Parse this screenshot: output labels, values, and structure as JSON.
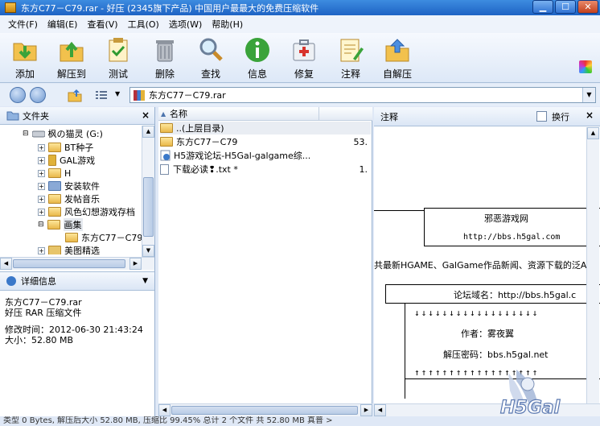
{
  "window": {
    "title": "东方C77－C79.rar - 好压 (2345旗下产品) 中国用户最最大的免费压缩软件",
    "minimize": "▁",
    "maximize": "☐",
    "close": "✕"
  },
  "menu": [
    "文件(F)",
    "编辑(E)",
    "查看(V)",
    "工具(O)",
    "选项(W)",
    "帮助(H)"
  ],
  "toolbar": [
    {
      "label": "添加",
      "icon": "add-icon"
    },
    {
      "label": "解压到",
      "icon": "extract-to-icon"
    },
    {
      "label": "测试",
      "icon": "test-icon"
    },
    {
      "label": "删除",
      "icon": "delete-icon"
    },
    {
      "label": "查找",
      "icon": "find-icon"
    },
    {
      "label": "信息",
      "icon": "info-icon"
    },
    {
      "label": "修复",
      "icon": "repair-icon"
    },
    {
      "label": "注释",
      "icon": "comment-icon"
    },
    {
      "label": "自解压",
      "icon": "sfx-icon"
    }
  ],
  "address": {
    "path": "东方C77－C79.rar"
  },
  "folder_panel": {
    "title": "文件夹",
    "close": "×",
    "tree": [
      {
        "label": "枫の猫灵 (G:)",
        "indent": 0,
        "kind": "drive"
      },
      {
        "label": "BT种子",
        "indent": 1,
        "kind": "folder"
      },
      {
        "label": "GAL游戏",
        "indent": 1,
        "kind": "folder"
      },
      {
        "label": "H",
        "indent": 1,
        "kind": "folder"
      },
      {
        "label": "安装软件",
        "indent": 1,
        "kind": "folder"
      },
      {
        "label": "发帖音乐",
        "indent": 1,
        "kind": "folder"
      },
      {
        "label": "风色幻想游戏存档",
        "indent": 1,
        "kind": "folder"
      },
      {
        "label": "画集",
        "indent": 1,
        "kind": "folder"
      },
      {
        "label": "东方C77－C79",
        "indent": 2,
        "kind": "folder"
      },
      {
        "label": "美图精选",
        "indent": 1,
        "kind": "folder"
      }
    ]
  },
  "details_panel": {
    "title": "详细信息",
    "name": "东方C77－C79.rar",
    "type": "好压 RAR 压缩文件",
    "modified": "修改时间：2012-06-30 21:43:24",
    "size": "大小：52.80 MB"
  },
  "file_list": {
    "column_name": "名称",
    "rows": [
      {
        "name": "..(上层目录)",
        "size": "",
        "kind": "folder"
      },
      {
        "name": "东方C77－C79",
        "size": "53.",
        "kind": "folder"
      },
      {
        "name": "H5游戏论坛-H5Gal-galgame综...",
        "size": "",
        "kind": "link"
      },
      {
        "name": "下载必读❢.txt *",
        "size": "1.",
        "kind": "doc"
      }
    ]
  },
  "comment_panel": {
    "title": "注释",
    "wrap_label": "换行",
    "close": "×",
    "site_name": "邪恶游戏网",
    "site_url": "http://bbs.h5gal.com",
    "tagline": "共最新HGAME、GalGame作品新闻、资源下载的泛ACG",
    "domain_line": "论坛域名：http://bbs.h5gal.c",
    "arrows_down": "↓↓↓↓↓↓↓↓↓↓↓↓↓↓↓↓↓↓",
    "author": "作者：雾夜翼",
    "password": "解压密码：bbs.h5gal.net",
    "arrows_up": "↑↑↑↑↑↑↑↑↑↑↑↑↑↑↑↑↑↑"
  },
  "status": "类型 0 Bytes, 解压后大小 52.80 MB, 压缩比 99.45% 总计 2 个文件 共 52.80 MB 真普 >",
  "watermark_text": "H5Gal"
}
